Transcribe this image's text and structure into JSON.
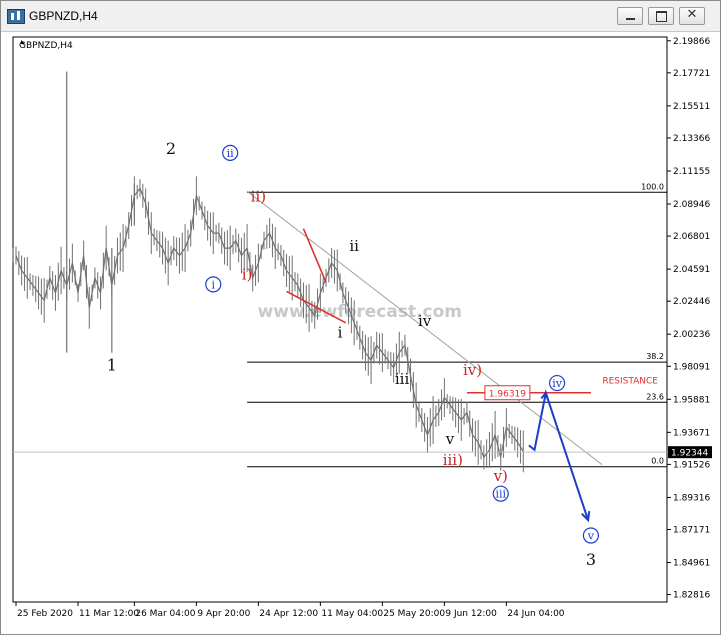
{
  "window": {
    "title": "GBPNZD,H4",
    "icon": "chart-app-icon",
    "minimize_icon": "minimize-icon",
    "maximize_icon": "maximize-icon",
    "close_icon": "close-icon",
    "close_glyph": "✕"
  },
  "chart_data": {
    "type": "line",
    "title": "GBPNZD,H4",
    "watermark": "www.ewforecast.com",
    "ylim": [
      1.8232,
      2.2012
    ],
    "y_ticks": [
      "2.19866",
      "2.17721",
      "2.15511",
      "2.13366",
      "2.11155",
      "2.08946",
      "2.06801",
      "2.04591",
      "2.02446",
      "2.00236",
      "1.98091",
      "1.95881",
      "1.93671",
      "1.91526",
      "1.89316",
      "1.87171",
      "1.84961",
      "1.82816"
    ],
    "x_ticks": [
      "25 Feb 2020",
      "11 Mar 12:00",
      "26 Mar 04:00",
      "9 Apr 20:00",
      "24 Apr 12:00",
      "11 May 04:00",
      "25 May 20:00",
      "9 Jun 12:00",
      "24 Jun 04:00"
    ],
    "current_price": "1.92344",
    "x_range": [
      0,
      99
    ],
    "x_tick_positions": [
      0,
      11,
      21,
      32,
      43,
      54,
      65,
      76,
      87
    ],
    "series": [
      {
        "x": [
          0,
          1,
          2,
          3,
          4,
          5,
          6,
          7,
          8,
          9,
          10,
          11,
          12,
          13,
          14,
          15,
          16,
          17,
          18,
          19,
          20,
          21,
          22,
          23,
          24,
          25,
          26,
          27,
          28,
          29,
          30,
          31,
          32,
          33,
          34,
          35,
          36,
          37,
          38,
          39,
          40,
          41,
          42,
          43,
          44,
          45,
          46,
          47,
          48,
          49,
          50,
          51,
          52,
          53,
          54,
          55,
          56,
          57,
          58,
          59,
          60,
          61,
          62,
          63,
          64,
          65,
          66,
          67,
          68,
          69,
          70,
          71,
          72,
          73,
          74,
          75,
          76,
          77,
          78,
          79,
          80,
          81,
          82,
          83,
          84,
          85,
          86,
          87,
          88,
          89,
          90
        ],
        "values": [
          2.055,
          2.045,
          2.04,
          2.035,
          2.03,
          2.025,
          2.04,
          2.03,
          2.045,
          2.035,
          2.05,
          2.03,
          2.055,
          2.02,
          2.04,
          2.03,
          2.06,
          2.035,
          2.055,
          2.06,
          2.075,
          2.095,
          2.1,
          2.09,
          2.07,
          2.065,
          2.06,
          2.05,
          2.06,
          2.055,
          2.06,
          2.07,
          2.095,
          2.085,
          2.075,
          2.07,
          2.07,
          2.06,
          2.06,
          2.065,
          2.055,
          2.06,
          2.04,
          2.05,
          2.065,
          2.07,
          2.06,
          2.055,
          2.045,
          2.04,
          2.035,
          2.025,
          2.02,
          2.015,
          2.03,
          2.04,
          2.05,
          2.045,
          2.03,
          2.02,
          2.01,
          2.0,
          1.99,
          1.985,
          1.995,
          1.99,
          1.985,
          1.98,
          1.99,
          1.995,
          1.975,
          1.955,
          1.945,
          1.935,
          1.945,
          1.95,
          1.96,
          1.955,
          1.95,
          1.945,
          1.95,
          1.935,
          1.93,
          1.92,
          1.925,
          1.935,
          1.92,
          1.94,
          1.935,
          1.93,
          1.924
        ]
      }
    ],
    "spikes": [
      {
        "x": 9,
        "high": 2.178,
        "low": 1.99
      },
      {
        "x": 17,
        "high": 2.06,
        "low": 1.99
      },
      {
        "x": 21,
        "high": 2.103,
        "low": 2.075
      }
    ],
    "fib_levels": [
      {
        "label": "100.0",
        "price": 2.0973,
        "x_start": 41
      },
      {
        "label": "38.2",
        "price": 1.9837,
        "x_start": 41
      },
      {
        "label": "23.6",
        "price": 1.9568,
        "x_start": 41
      },
      {
        "label": "0.0",
        "price": 1.9137,
        "x_start": 41
      }
    ],
    "resistance": {
      "label": "RESISTANCE",
      "price_label": "1.96319",
      "price": 1.9632,
      "x_start": 80,
      "x_end": 102
    },
    "wave_labels": [
      {
        "text": "1",
        "x": 17,
        "price": 1.978,
        "color": "black",
        "circled": false
      },
      {
        "text": "2",
        "x": 27.5,
        "price": 2.123,
        "color": "black",
        "circled": false
      },
      {
        "text": "ii",
        "x": 38,
        "price": 2.121,
        "color": "blue",
        "circled": true
      },
      {
        "text": "i",
        "x": 35,
        "price": 2.033,
        "color": "blue",
        "circled": true
      },
      {
        "text": "i)",
        "x": 41,
        "price": 2.039,
        "color": "red",
        "circled": false
      },
      {
        "text": "ii)",
        "x": 43,
        "price": 2.091,
        "color": "red",
        "circled": false
      },
      {
        "text": "i",
        "x": 57.5,
        "price": 2.0,
        "color": "black",
        "circled": false
      },
      {
        "text": "ii",
        "x": 60,
        "price": 2.058,
        "color": "black",
        "circled": false
      },
      {
        "text": "iii",
        "x": 68.5,
        "price": 1.969,
        "color": "black",
        "circled": false
      },
      {
        "text": "iv",
        "x": 72.5,
        "price": 2.008,
        "color": "black",
        "circled": false
      },
      {
        "text": "v",
        "x": 77,
        "price": 1.929,
        "color": "black",
        "circled": false
      },
      {
        "text": "iii)",
        "x": 77.5,
        "price": 1.915,
        "color": "red",
        "circled": false
      },
      {
        "text": "iv)",
        "x": 81,
        "price": 1.975,
        "color": "red",
        "circled": false
      },
      {
        "text": "v)",
        "x": 86,
        "price": 1.904,
        "color": "red",
        "circled": false
      },
      {
        "text": "iii",
        "x": 86,
        "price": 1.893,
        "color": "blue",
        "circled": true
      },
      {
        "text": "iv",
        "x": 96,
        "price": 1.967,
        "color": "blue",
        "circled": true
      },
      {
        "text": "v",
        "x": 102,
        "price": 1.865,
        "color": "blue",
        "circled": true
      },
      {
        "text": "3",
        "x": 102,
        "price": 1.848,
        "color": "black",
        "circled": false
      }
    ],
    "wedge": [
      {
        "x1": 51,
        "y1": 2.073,
        "x2": 55,
        "y2": 2.037
      },
      {
        "x1": 48,
        "y1": 2.031,
        "x2": 58.5,
        "y2": 2.01
      }
    ],
    "trendline": {
      "x1": 41,
      "y1": 2.098,
      "x2": 104,
      "y2": 1.915
    },
    "projection": [
      {
        "x": 91,
        "price": 1.928
      },
      {
        "x": 92,
        "price": 1.925
      },
      {
        "x": 94,
        "price": 1.963
      },
      {
        "x": 101.5,
        "price": 1.878
      }
    ],
    "colors": {
      "price": "#707070",
      "fib_line": "#000000",
      "fib_text": "#000000",
      "resistance": "#e03030",
      "red_wave": "#cc2222",
      "blue_wave": "#1a3ec8",
      "black_wave": "#111111",
      "trendline": "#a0a0a0",
      "projection": "#1a3ec8",
      "watermark": "#c8c8c8"
    }
  }
}
